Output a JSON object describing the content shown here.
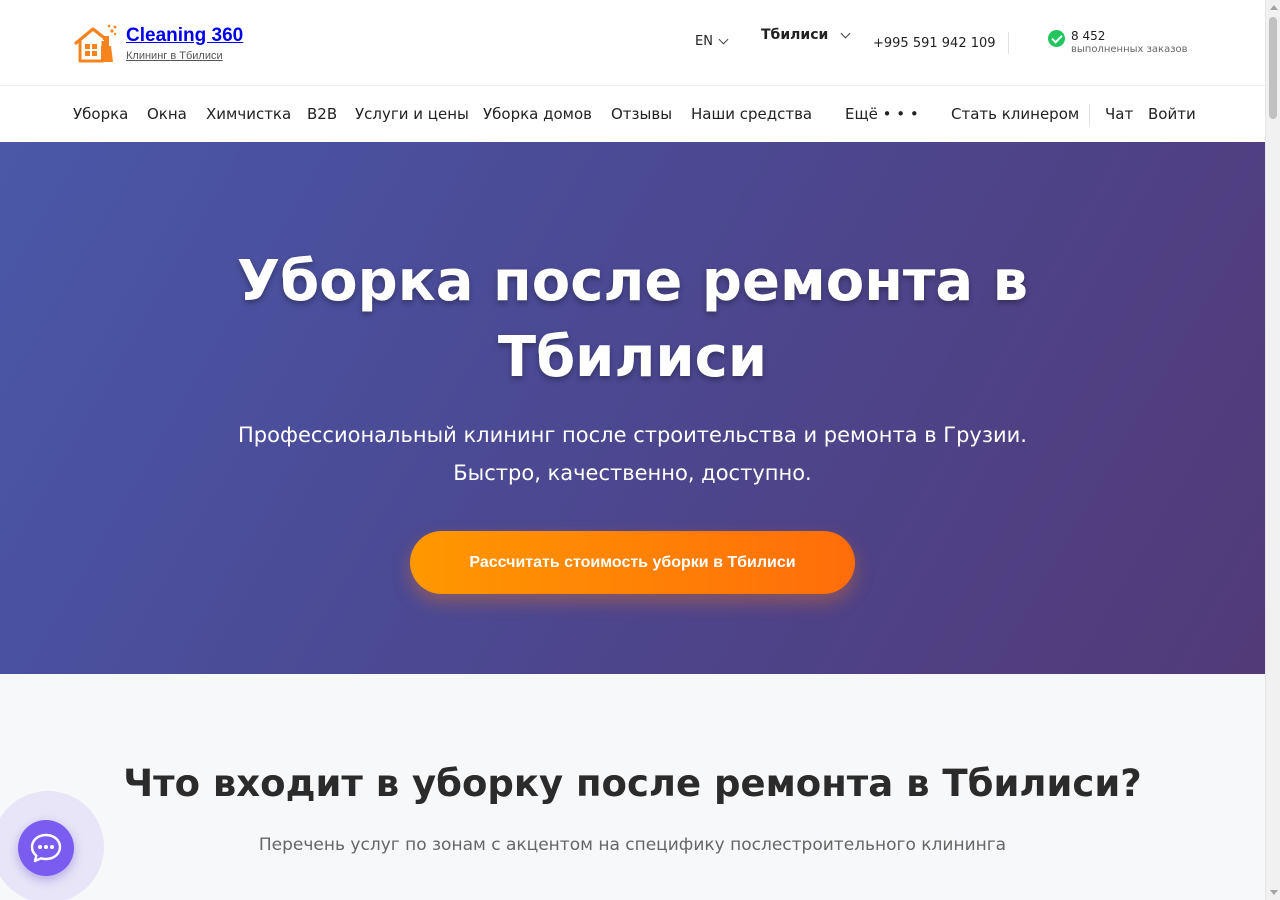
{
  "header": {
    "logo_title": "Cleaning 360",
    "logo_subtitle": "Клининг в Тбилиси",
    "language": "EN",
    "city": "Тбилиси",
    "phone": "+995 591 942 109",
    "orders_count": "8 452",
    "orders_label": "выполненных заказов"
  },
  "nav": {
    "items": [
      "Уборка",
      "Окна",
      "Химчистка",
      "B2B",
      "Услуги и цены",
      "Уборка домов",
      "Отзывы",
      "Наши средства"
    ],
    "more": "Ещё • • •",
    "become_cleaner": "Стать клинером",
    "chat": "Чат",
    "login": "Войти"
  },
  "hero": {
    "title_line1": "Уборка после ремонта в",
    "title_line2": "Тбилиси",
    "subtitle_line1": "Профессиональный клининг после строительства и ремонта в Грузии.",
    "subtitle_line2": "Быстро, качественно, доступно.",
    "cta": "Рассчитать стоимость уборки в Тбилиси"
  },
  "section": {
    "title": "Что входит в уборку после ремонта в Тбилиси?",
    "subtitle": "Перечень услуг по зонам с акцентом на специфику послестроительного клининга"
  },
  "colors": {
    "hero_start": "#4a58a8",
    "hero_end": "#523a78",
    "cta_start": "#ff9800",
    "cta_end": "#ff6d0a",
    "chat": "#7a5cf0",
    "check": "#22c55e",
    "logo_orange": "#f5841f"
  },
  "icons": {
    "logo": "house-spray-icon",
    "check": "check-circle-icon",
    "chat": "chat-bubble-icon"
  }
}
